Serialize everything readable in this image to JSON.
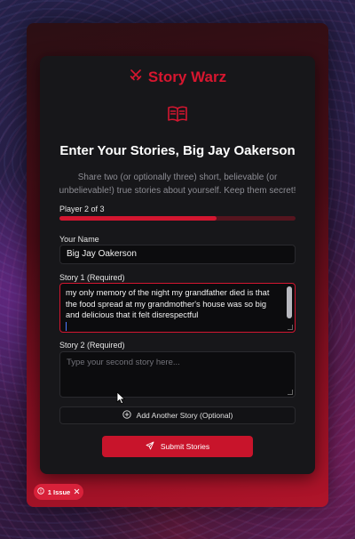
{
  "brand": {
    "name": "Story Warz",
    "icon": "crossed-swords-icon"
  },
  "header": {
    "icon": "open-book-icon",
    "title": "Enter Your Stories, Big Jay Oakerson",
    "subtitle": "Share two (or optionally three) short, believable (or unbelievable!) true stories about yourself. Keep them secret!"
  },
  "progress": {
    "label": "Player 2 of 3",
    "fraction": 0.667
  },
  "form": {
    "name_label": "Your Name",
    "name_value": "Big Jay Oakerson",
    "story1_label": "Story 1 (Required)",
    "story1_value": "my only memory of the night my grandfather died is that the food spread at my grandmother's house was so big and delicious that it felt disrespectful",
    "story2_label": "Story 2 (Required)",
    "story2_placeholder": "Type your second story here...",
    "add_story_label": "Add Another Story (Optional)",
    "submit_label": "Submit Stories"
  },
  "issue_badge": {
    "label": "1 Issue"
  },
  "colors": {
    "accent": "#d31630",
    "card": "#17171a",
    "field": "#0c0c0e"
  }
}
